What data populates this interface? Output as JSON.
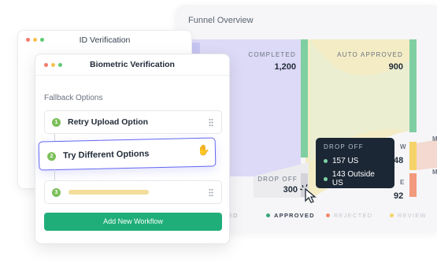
{
  "funnel": {
    "title": "Funnel Overview",
    "stages": [
      {
        "label": "COMPLETED",
        "value": "1,200"
      },
      {
        "label": "AUTO APPROVED",
        "value": "900"
      },
      {
        "label": "DROP OFF",
        "value": "300"
      }
    ],
    "partial_tabs": {
      "w": "W",
      "val_48": "48",
      "e": "E",
      "val_92": "92",
      "m1": "M",
      "m2": "M"
    },
    "legend": [
      {
        "label": "TED",
        "color": "#c7cad9"
      },
      {
        "label": "APPROVED",
        "color": "#3aa57a"
      },
      {
        "label": "REJECTED",
        "color": "#f08a6b"
      },
      {
        "label": "REVIEW",
        "color": "#f5d36a"
      }
    ],
    "colors": {
      "completed": "#d7d6f5",
      "approved": "#7fcfa2",
      "review": "#f3e8b0",
      "rejected": "#f4b4a0"
    }
  },
  "tooltip": {
    "title": "DROP OFF",
    "rows": [
      "157 US",
      "143 Outside US"
    ]
  },
  "id_window": {
    "title": "ID Verification",
    "traffic_colors": [
      "#f47a6b",
      "#f5c04f",
      "#5ecb73"
    ]
  },
  "bio_window": {
    "title": "Biometric Verification",
    "fallback_label": "Fallback Options",
    "options": [
      {
        "num": "1",
        "label": "Retry Upload Option"
      },
      {
        "num": "2",
        "label": "Try Different Options"
      },
      {
        "num": "3",
        "label": ""
      }
    ],
    "add_button": "Add New Workflow"
  }
}
